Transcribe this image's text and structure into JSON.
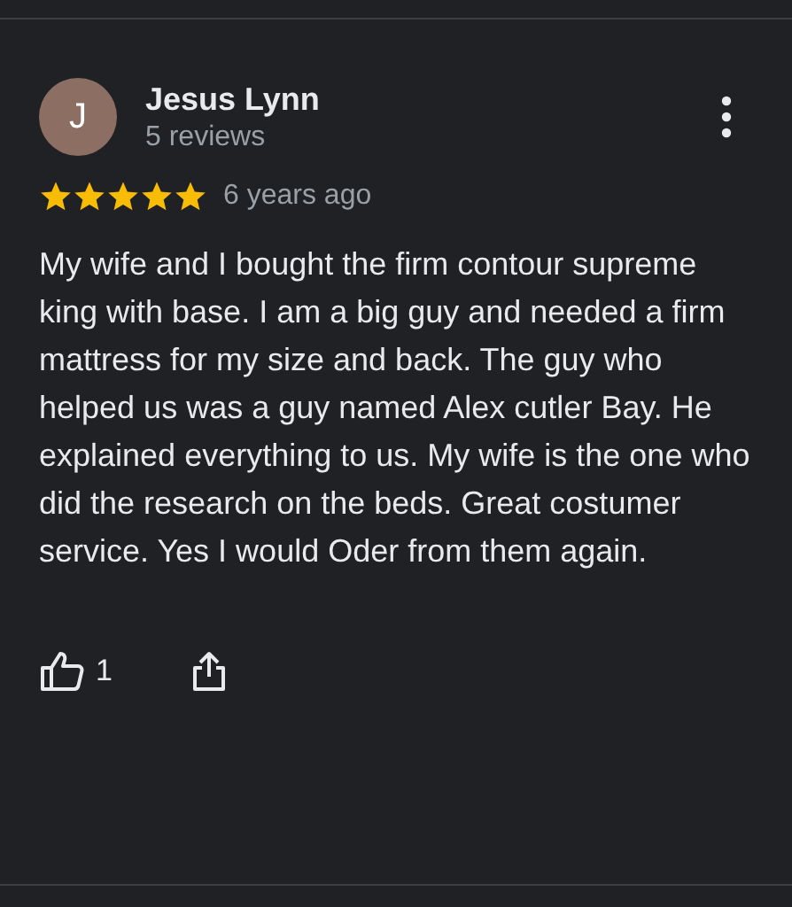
{
  "review": {
    "avatar_letter": "J",
    "author": "Jesus Lynn",
    "author_meta": "5 reviews",
    "stars": 5,
    "time": "6 years ago",
    "text": "My wife and I bought the firm contour supreme king with base. I am a big guy and needed a firm mattress for my size and back. The guy who helped us was a guy named Alex cutler Bay. He explained everything to us. My wife is the one who did the research on the beds. Great costumer service. Yes I would Oder from them again.",
    "likes": "1"
  }
}
